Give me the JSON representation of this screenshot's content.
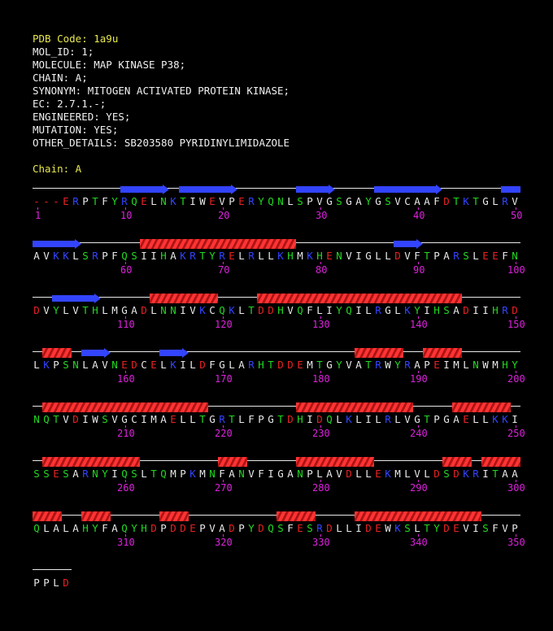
{
  "header": {
    "lines": [
      "PDB Code: 1a9u",
      "MOL_ID: 1;",
      "MOLECULE: MAP KINASE P38;",
      "CHAIN: A;",
      "SYNONYM: MITOGEN ACTIVATED PROTEIN KINASE;",
      "EC: 2.7.1.-;",
      "ENGINEERED: YES;",
      "MUTATION: YES;",
      "OTHER_DETAILS: SB203580 PYRIDINYLIMIDAZOLE"
    ],
    "chain_label": "Chain: A"
  },
  "colors": {
    "hydrophobic": "#e8e8e8",
    "polar": "#22d822",
    "acidic": "#e82222",
    "basic": "#3344ff",
    "gap": "#e82222",
    "sheet": "#3344ff",
    "helix": "#ff3333",
    "number": "#dd22dd",
    "title": "#e8e850"
  },
  "sequence": {
    "first_residue_number": 1,
    "rows": [
      {
        "seq": "---ERPTFYRQELNKTIWEVPERYQNLSPVGSGAYGSVCAAFDTKTGLRV",
        "numbers": [
          "1",
          "10",
          "20",
          "30",
          "40",
          "50"
        ],
        "sheets": [
          [
            9,
            13
          ],
          [
            15,
            20
          ],
          [
            27,
            30
          ],
          [
            35,
            41
          ],
          [
            48,
            49
          ]
        ],
        "helices": []
      },
      {
        "seq": "AVKKLSRPFQSIIHAKRTYRELRLLKHMKHENVIGLLDVFTPARSLEEFN",
        "numbers": [
          "60",
          "70",
          "80",
          "90",
          "100"
        ],
        "sheets": [
          [
            0,
            4
          ],
          [
            37,
            39
          ]
        ],
        "helices": [
          [
            11,
            26
          ]
        ]
      },
      {
        "seq": "DVYLVTHLMGADLNNIVKCQKLTDDHVQFLIYQILRGLKYIHSADIIHRD",
        "numbers": [
          "110",
          "120",
          "130",
          "140",
          "150"
        ],
        "sheets": [
          [
            2,
            6
          ]
        ],
        "helices": [
          [
            12,
            18
          ],
          [
            23,
            43
          ]
        ]
      },
      {
        "seq": "LKPSNLAVNEDCELKILDFGLARHTDDEMTGYVATRWYRAPEIMLNWMHY",
        "numbers": [
          "160",
          "170",
          "180",
          "190",
          "200"
        ],
        "sheets": [
          [
            5,
            7
          ],
          [
            13,
            15
          ]
        ],
        "helices": [
          [
            1,
            3
          ],
          [
            33,
            37
          ],
          [
            40,
            43
          ]
        ]
      },
      {
        "seq": "NQTVDIWSVGCIMAELLTGRTLFPGTDHIDQLKLILRLVGTPGAELLKKI",
        "numbers": [
          "210",
          "220",
          "230",
          "240",
          "250"
        ],
        "sheets": [],
        "helices": [
          [
            1,
            17
          ],
          [
            27,
            38
          ],
          [
            43,
            48
          ]
        ]
      },
      {
        "seq": "SSESARNYIQSLTQMPKMNFANVFIGANPLAVDLLEKMLVLDSDKRITAA",
        "numbers": [
          "260",
          "270",
          "280",
          "290",
          "300"
        ],
        "sheets": [],
        "helices": [
          [
            1,
            10
          ],
          [
            19,
            21
          ],
          [
            27,
            34
          ],
          [
            42,
            44
          ],
          [
            46,
            49
          ]
        ]
      },
      {
        "seq": "QLALAHYFAQYHDPDDEPVADPYDQSFESRDLLIDEWKSLTYDEVISFVP",
        "numbers": [
          "310",
          "320",
          "330",
          "340",
          "350"
        ],
        "sheets": [],
        "helices": [
          [
            0,
            2
          ],
          [
            5,
            7
          ],
          [
            13,
            15
          ],
          [
            25,
            28
          ],
          [
            33,
            45
          ]
        ]
      },
      {
        "seq": "PPLD",
        "numbers": [],
        "sheets": [],
        "helices": []
      }
    ]
  }
}
